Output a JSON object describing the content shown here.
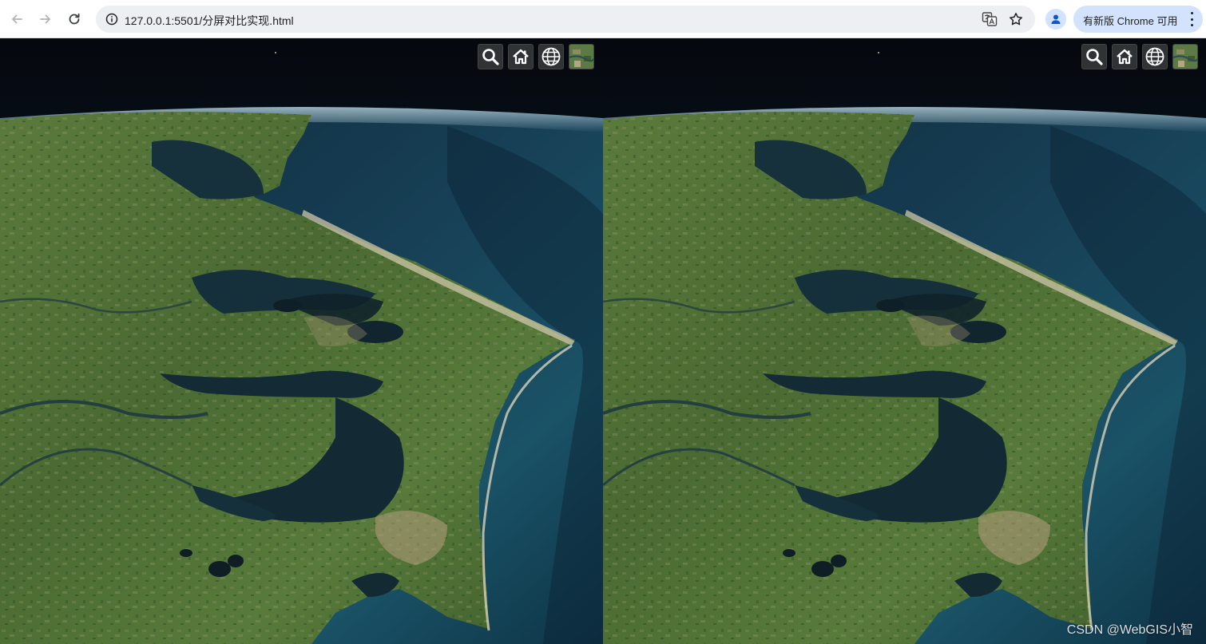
{
  "browser": {
    "url": "127.0.0.1:5501/分屏对比实现.html",
    "update_label": "有新版 Chrome 可用"
  },
  "viewers": {
    "left": {
      "toolbar": [
        "search-icon",
        "home-icon",
        "globe-icon",
        "layer-picker-icon"
      ]
    },
    "right": {
      "toolbar": [
        "search-icon",
        "home-icon",
        "globe-icon",
        "layer-picker-icon"
      ]
    }
  },
  "watermark": "CSDN @WebGIS小智",
  "colors": {
    "space": "#05080d",
    "atmosphere": "#bfe0ef",
    "ocean": "#123a4e",
    "land": "#4c6b34",
    "water_inland": "#162c36",
    "toolbar_button": "#303336"
  }
}
